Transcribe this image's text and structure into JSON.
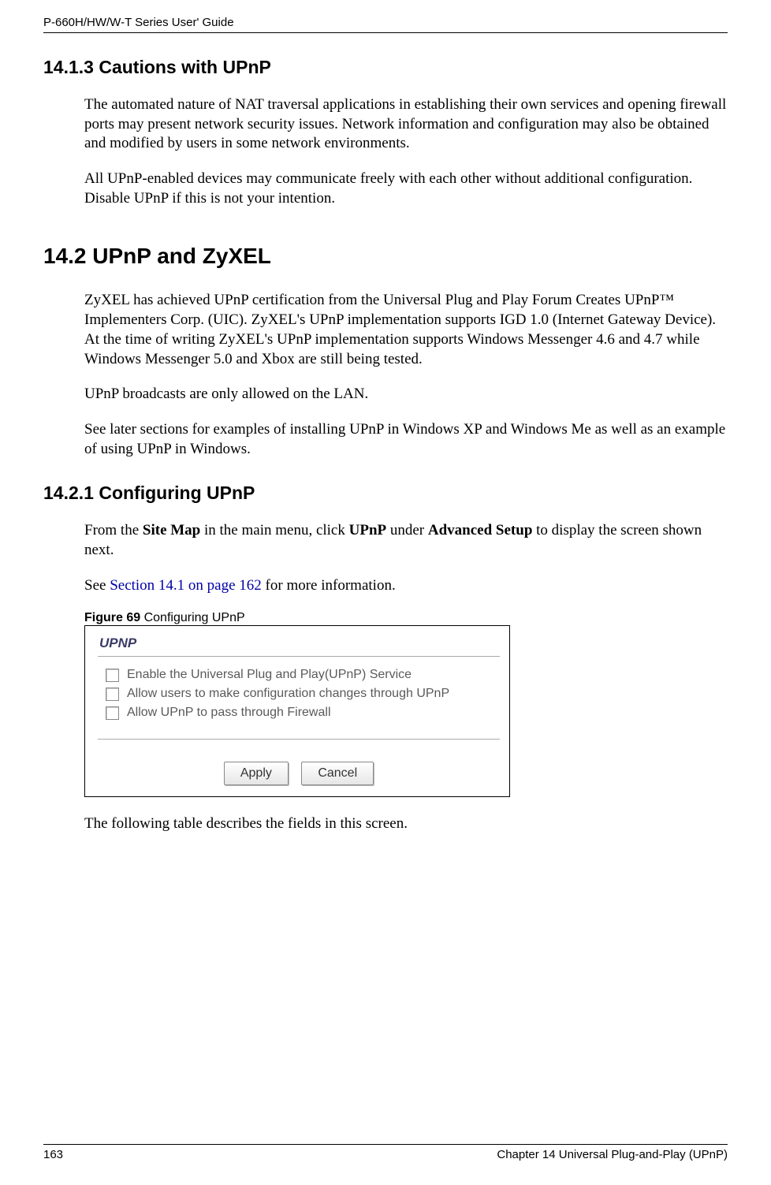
{
  "header": {
    "guide_title": "P-660H/HW/W-T Series User' Guide"
  },
  "sections": {
    "s1": {
      "heading": "14.1.3  Cautions with UPnP",
      "p1": "The automated nature of NAT traversal applications in establishing their own services and opening firewall ports may present network security issues. Network information and configuration may also be obtained and modified by users in some network environments.",
      "p2": "All UPnP-enabled devices may communicate freely with each other without additional configuration. Disable UPnP if this is not your intention."
    },
    "s2": {
      "heading": "14.2  UPnP and ZyXEL",
      "p1": "ZyXEL has achieved UPnP certification from the Universal Plug and Play Forum Creates UPnP™ Implementers Corp. (UIC). ZyXEL's UPnP implementation supports IGD 1.0 (Internet Gateway Device). At the time of writing ZyXEL's UPnP implementation supports Windows Messenger 4.6 and 4.7 while Windows Messenger 5.0 and Xbox are still being tested.",
      "p2": "UPnP broadcasts are only allowed on the LAN.",
      "p3": "See later sections for examples of installing UPnP in Windows XP and Windows Me as well as an example of using UPnP in Windows."
    },
    "s3": {
      "heading": "14.2.1  Configuring UPnP",
      "p1_pre": "From the ",
      "p1_b1": "Site Map",
      "p1_mid1": " in the main menu, click ",
      "p1_b2": "UPnP",
      "p1_mid2": " under ",
      "p1_b3": "Advanced Setup",
      "p1_post": " to display the screen shown next.",
      "p2_pre": "See ",
      "p2_link": "Section 14.1 on page 162",
      "p2_post": " for more information."
    }
  },
  "figure": {
    "label": "Figure 69",
    "caption": "   Configuring UPnP",
    "panel_title": "UPNP",
    "options": [
      "Enable the Universal Plug and Play(UPnP) Service",
      "Allow users to make configuration changes through UPnP",
      "Allow UPnP to pass through Firewall"
    ],
    "apply_label": "Apply",
    "cancel_label": "Cancel"
  },
  "after_figure": {
    "p1": "The following table describes the fields in this screen."
  },
  "footer": {
    "page_number": "163",
    "chapter": "Chapter 14 Universal Plug-and-Play (UPnP)"
  }
}
